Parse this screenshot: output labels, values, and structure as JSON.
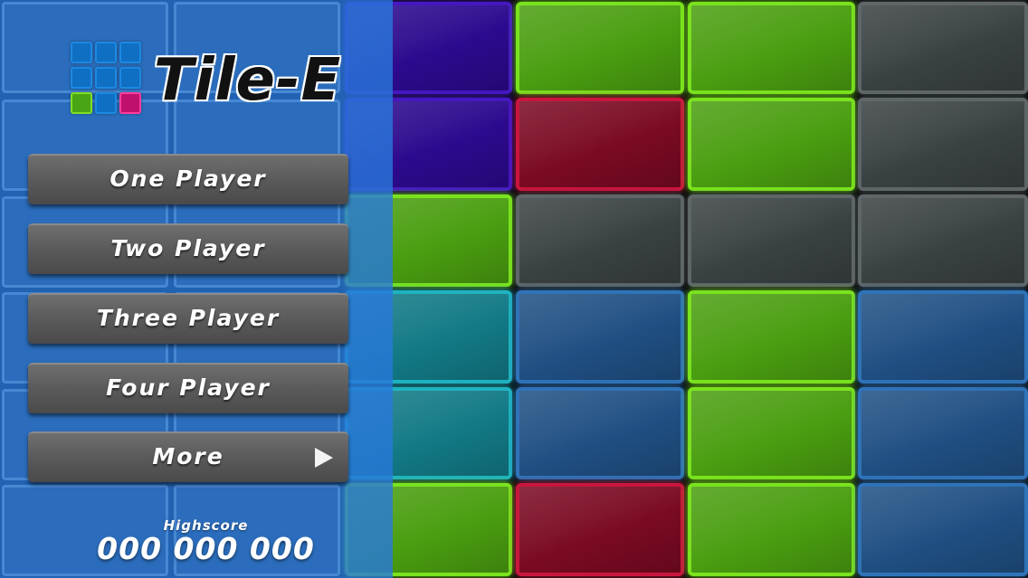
{
  "game": {
    "title": "Tile-E"
  },
  "menu": {
    "buttons": [
      {
        "label": "One Player"
      },
      {
        "label": "Two Player"
      },
      {
        "label": "Three Player"
      },
      {
        "label": "Four Player"
      },
      {
        "label": "More",
        "icon": "play-arrow-icon"
      }
    ]
  },
  "highscore": {
    "label": "Highscore",
    "value": "000 000 000"
  },
  "board": {
    "rows": [
      [
        "purple",
        "green",
        "green",
        "gray"
      ],
      [
        "purple",
        "red",
        "green",
        "gray"
      ],
      [
        "green",
        "gray",
        "gray",
        "gray"
      ],
      [
        "teal",
        "blue",
        "green",
        "blue"
      ],
      [
        "teal",
        "blue",
        "green",
        "blue"
      ],
      [
        "green",
        "red",
        "green",
        "blue"
      ]
    ],
    "colors": {
      "green": "#7ae21e",
      "red": "#c8163e",
      "gray": "#5e6667",
      "blue": "#2f73b8",
      "purple": "#4418c0",
      "teal": "#1fb2c0"
    }
  },
  "logo": {
    "icon": "tile-grid-logo-icon",
    "grid": [
      [
        "blue",
        "blue",
        "blue"
      ],
      [
        "blue",
        "blue",
        "blue"
      ],
      [
        "green",
        "blue",
        "pink"
      ]
    ]
  },
  "colors": {
    "panel_blue": "#2878dc",
    "button_gray": "#5c5c5d"
  }
}
